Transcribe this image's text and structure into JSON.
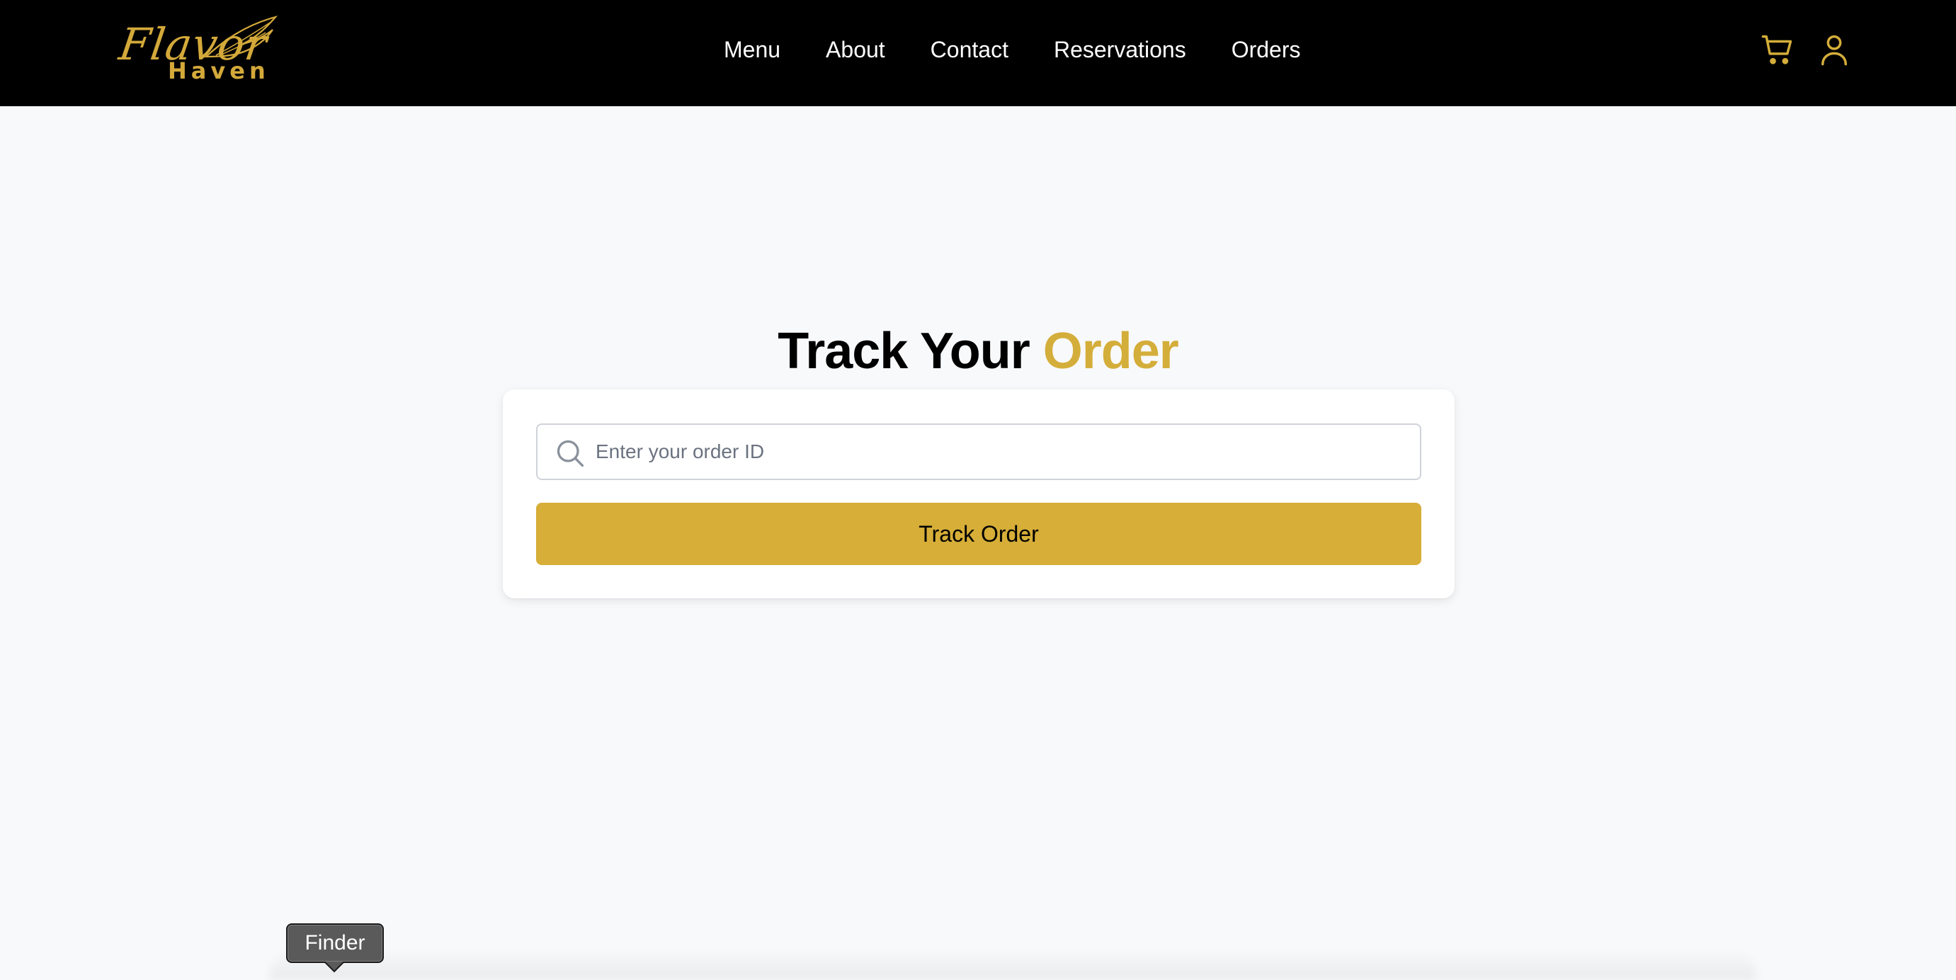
{
  "brand": {
    "script": "Flavor",
    "word": "Haven",
    "accent_color": "#d4a93a"
  },
  "nav": {
    "links": [
      "Menu",
      "About",
      "Contact",
      "Reservations",
      "Orders"
    ]
  },
  "header_icons": {
    "cart": "shopping-cart-icon",
    "user": "user-icon"
  },
  "page": {
    "title_main": "Track Your",
    "title_accent": "Order"
  },
  "form": {
    "search_placeholder": "Enter your order ID",
    "search_value": "",
    "search_icon": "search-icon",
    "button_label": "Track Order",
    "button_color": "#d6ae38"
  },
  "dock": {
    "tooltip": "Finder"
  }
}
